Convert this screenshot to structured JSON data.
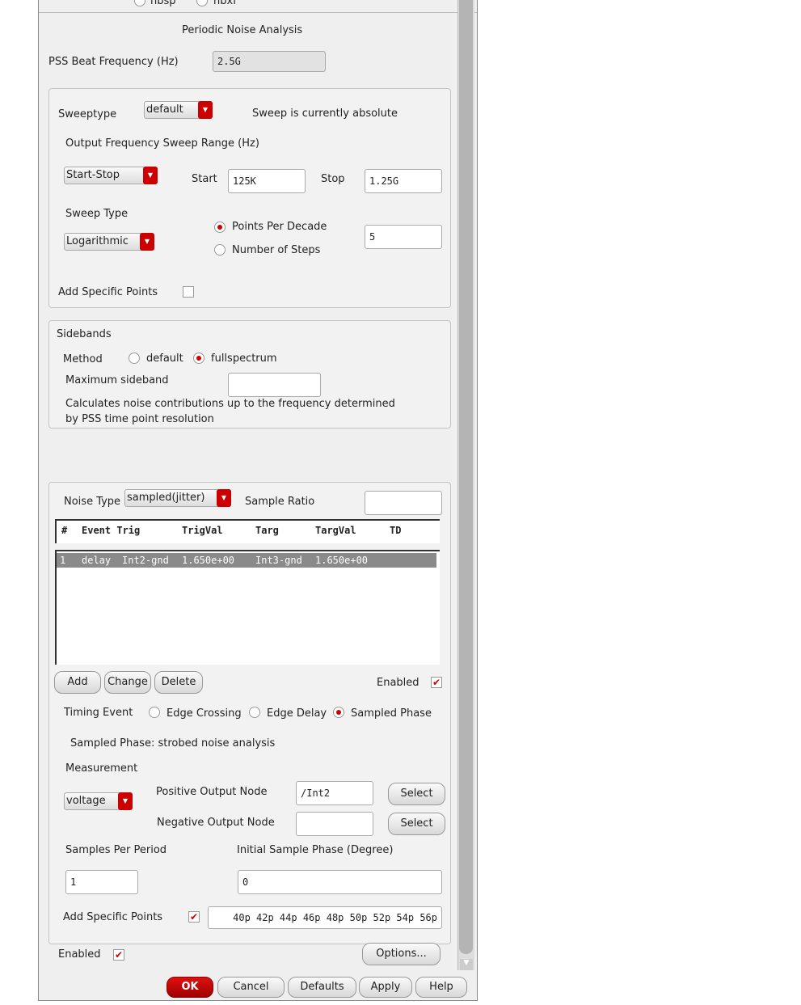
{
  "top_radios": [
    "nbsp",
    "nbxf"
  ],
  "section_title": "Periodic Noise Analysis",
  "pss_beat": {
    "label": "PSS Beat Frequency (Hz)",
    "value": "2.5G"
  },
  "sweep": {
    "sweeptype_label": "Sweeptype",
    "sweeptype_value": "default",
    "status": "Sweep is currently absolute",
    "range_label": "Output Frequency Sweep Range (Hz)",
    "range_mode": "Start-Stop",
    "start_label": "Start",
    "start_value": "125K",
    "stop_label": "Stop",
    "stop_value": "1.25G",
    "type_label": "Sweep Type",
    "type_value": "Logarithmic",
    "ppd_label": "Points Per Decade",
    "steps_label": "Number of Steps",
    "points_value": "5",
    "specific_label": "Add Specific Points"
  },
  "sidebands": {
    "title": "Sidebands",
    "method_label": "Method",
    "opt_default": "default",
    "opt_full": "fullspectrum",
    "max_label": "Maximum sideband",
    "max_value": "",
    "note1": "Calculates noise contributions up to the frequency determined",
    "note2": "by PSS time point resolution"
  },
  "noise": {
    "type_label": "Noise Type",
    "type_value": "sampled(jitter)",
    "ratio_label": "Sample Ratio",
    "ratio_value": "",
    "columns": [
      "#",
      "Event Trig",
      "TrigVal",
      "Targ",
      "TargVal",
      "TD"
    ],
    "rows": [
      [
        "1",
        "delay",
        "Int2-gnd",
        "1.650e+00",
        "Int3-gnd",
        "1.650e+00"
      ]
    ],
    "add": "Add",
    "change": "Change",
    "delete": "Delete",
    "enabled_label": "Enabled",
    "timing_label": "Timing Event",
    "edge_crossing": "Edge Crossing",
    "edge_delay": "Edge Delay",
    "sampled_phase": "Sampled Phase",
    "phase_note": "Sampled Phase: strobed noise analysis",
    "measurement_label": "Measurement",
    "measurement_value": "voltage",
    "pos_label": "Positive Output Node",
    "pos_value": "/Int2",
    "neg_label": "Negative Output Node",
    "neg_value": "",
    "select": "Select",
    "spp_label": "Samples Per Period",
    "spp_value": "1",
    "isp_label": "Initial Sample Phase (Degree)",
    "isp_value": "0",
    "specific_label": "Add Specific Points",
    "specific_value": "40p 42p 44p 46p 48p 50p 52p 54p 56p"
  },
  "enabled_label": "Enabled",
  "buttons": {
    "options": "Options...",
    "ok": "OK",
    "cancel": "Cancel",
    "defaults": "Defaults",
    "apply": "Apply",
    "help": "Help"
  }
}
